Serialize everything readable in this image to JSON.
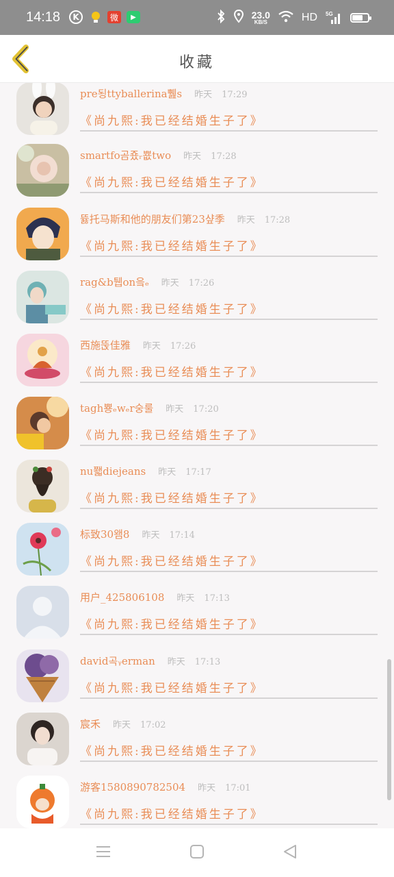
{
  "status_bar": {
    "time": "14:18",
    "k_icon": "K",
    "weibo_icon": "微",
    "video_icon": "▶",
    "speed_value": "23.0",
    "speed_unit": "KB/S",
    "network": "HD",
    "signal": "5G"
  },
  "header": {
    "title": "收藏",
    "accent": "#e2c233"
  },
  "colors": {
    "text_accent": "#e98d56",
    "meta": "#bdbdbd",
    "divider": "#d5d3d4"
  },
  "list": {
    "items": [
      {
        "username": "pre됭ttyballerina쀒s",
        "day": "昨天",
        "time": "17:29",
        "desc": "《尚九熙:我已经结婚生子了》"
      },
      {
        "username": "smartfo곰죴ᵣ뿂two",
        "day": "昨天",
        "time": "17:28",
        "desc": "《尚九熙:我已经结婚生子了》"
      },
      {
        "username": "뜛托马斯和他的朋友们第23샾季",
        "day": "昨天",
        "time": "17:28",
        "desc": "《尚九熙:我已经结婚生子了》"
      },
      {
        "username": "rag&b퉵on읔ₑ",
        "day": "昨天",
        "time": "17:26",
        "desc": "《尚九熙:我已经结婚生子了》"
      },
      {
        "username": "西施뚡佳雅",
        "day": "昨天",
        "time": "17:26",
        "desc": "《尚九熙:我已经结婚生子了》"
      },
      {
        "username": "tagh뿅ₑwₑr숭룰",
        "day": "昨天",
        "time": "17:20",
        "desc": "《尚九熙:我已经结婚生子了》"
      },
      {
        "username": "nu쫿diejeans",
        "day": "昨天",
        "time": "17:17",
        "desc": "《尚九熙:我已经结婚生子了》"
      },
      {
        "username": "标致30왬8",
        "day": "昨天",
        "time": "17:14",
        "desc": "《尚九熙:我已经结婚生子了》"
      },
      {
        "username": "用户_425806108",
        "day": "昨天",
        "time": "17:13",
        "desc": "《尚九熙:我已经结婚生子了》"
      },
      {
        "username": "david곡ᵧerman",
        "day": "昨天",
        "time": "17:13",
        "desc": "《尚九熙:我已经结婚生子了》"
      },
      {
        "username": "宸禾",
        "day": "昨天",
        "time": "17:02",
        "desc": "《尚九熙:我已经结婚生子了》"
      },
      {
        "username": "游客1580890782504",
        "day": "昨天",
        "time": "17:01",
        "desc": "《尚九熙:我已经结婚生子了》"
      }
    ]
  },
  "nav": {
    "menu_icon": "menu-icon",
    "home_icon": "home-icon",
    "back_icon": "back-triangle-icon"
  }
}
